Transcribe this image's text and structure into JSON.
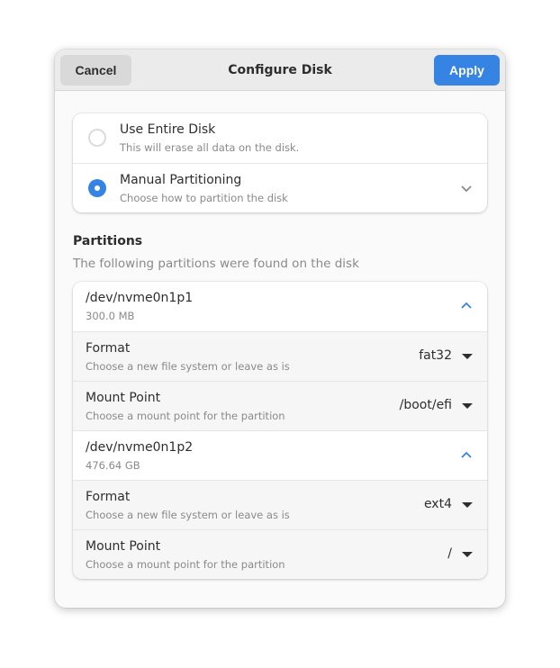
{
  "header": {
    "cancel_label": "Cancel",
    "title": "Configure Disk",
    "apply_label": "Apply"
  },
  "options": [
    {
      "title": "Use Entire Disk",
      "subtitle": "This will erase all data on the disk.",
      "selected": false
    },
    {
      "title": "Manual Partitioning",
      "subtitle": "Choose how to partition the disk",
      "selected": true
    }
  ],
  "partitions_section": {
    "title": "Partitions",
    "subtitle": "The following partitions were found on the disk"
  },
  "partitions": [
    {
      "device": "/dev/nvme0n1p1",
      "size": "300.0 MB",
      "format": {
        "label": "Format",
        "subtitle": "Choose a new file system or leave as is",
        "value": "fat32"
      },
      "mount": {
        "label": "Mount Point",
        "subtitle": "Choose a mount point for the partition",
        "value": "/boot/efi"
      }
    },
    {
      "device": "/dev/nvme0n1p2",
      "size": "476.64 GB",
      "format": {
        "label": "Format",
        "subtitle": "Choose a new file system or leave as is",
        "value": "ext4"
      },
      "mount": {
        "label": "Mount Point",
        "subtitle": "Choose a mount point for the partition",
        "value": "/"
      }
    }
  ],
  "colors": {
    "accent": "#3584e4"
  }
}
